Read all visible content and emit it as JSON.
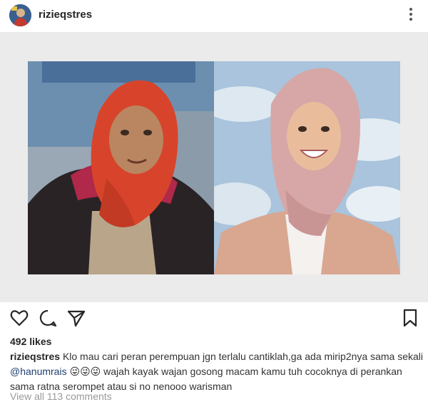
{
  "post": {
    "username": "rizieqstres",
    "likes_text": "492 likes",
    "caption": {
      "username": "rizieqstres",
      "text_part1": "Klo mau cari peran perempuan jgn terlalu cantiklah,ga ada mirip2nya sama sekali",
      "mention": "@hanumrais",
      "emojis": "😜😜😜",
      "text_part2": "wajah kayak wajan gosong macam kamu tuh cocoknya di perankan sama ratna serompet atau si no nenooo warisman"
    },
    "view_comments": "View all 113 comments"
  },
  "icons": {
    "more": "more-vertical-icon",
    "like": "heart-icon",
    "comment": "comment-icon",
    "share": "send-icon",
    "save": "bookmark-icon"
  }
}
